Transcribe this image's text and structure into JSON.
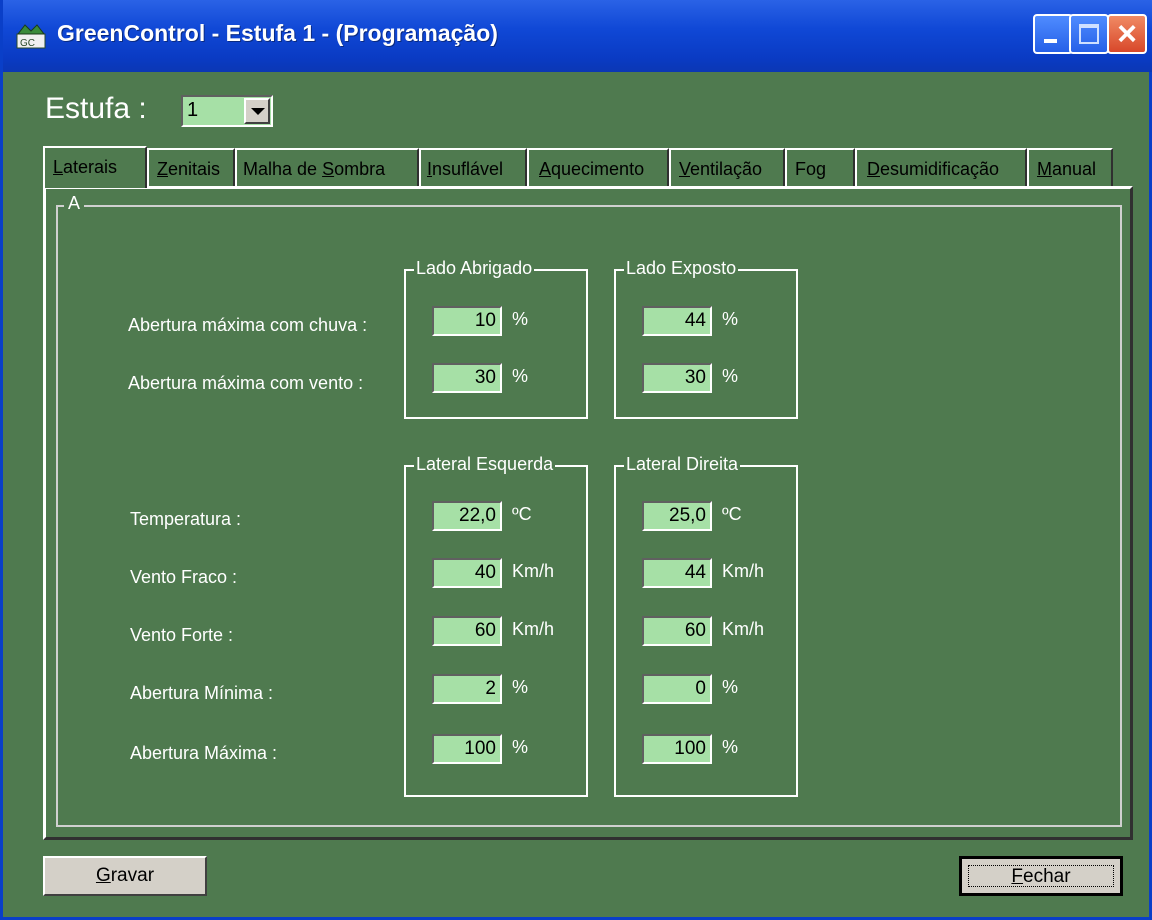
{
  "window": {
    "title": "GreenControl - Estufa 1 - (Programação)",
    "colors": {
      "titlebar": "#0a3bc4",
      "background": "#4f7a4f",
      "field": "#a6e0a6"
    }
  },
  "estufa": {
    "label": "Estufa :",
    "selected": "1"
  },
  "tabs": [
    {
      "label": "Laterais",
      "hot": "L",
      "rest": "aterais"
    },
    {
      "label": "Zenitais",
      "hot": "Z",
      "rest": "enitais"
    },
    {
      "label": "Malha de Sombra",
      "pre": "Malha de ",
      "hot": "S",
      "rest": "ombra"
    },
    {
      "label": "Insuflável",
      "hot": "I",
      "rest": "nsuflável"
    },
    {
      "label": "Aquecimento",
      "hot": "A",
      "rest": "quecimento"
    },
    {
      "label": "Ventilação",
      "hot": "V",
      "rest": "entilação"
    },
    {
      "label": "Fog",
      "pre": "Fo",
      "hot": "g",
      "rest": ""
    },
    {
      "label": "Desumidificação",
      "hot": "D",
      "rest": "esumidificação"
    },
    {
      "label": "Manual",
      "hot": "M",
      "rest": "anual"
    }
  ],
  "panel": {
    "caption": "A"
  },
  "groups": {
    "lado_abrigado": "Lado Abrigado",
    "lado_exposto": "Lado Exposto",
    "lateral_esquerda": "Lateral Esquerda",
    "lateral_direita": "Lateral Direita"
  },
  "rows_top": [
    {
      "label": "Abertura máxima com chuva :",
      "abrigado": "10",
      "exposto": "44",
      "unit": "%"
    },
    {
      "label": "Abertura máxima com vento :",
      "abrigado": "30",
      "exposto": "30",
      "unit": "%"
    }
  ],
  "rows_bottom": [
    {
      "label": "Temperatura :",
      "esquerda": "22,0",
      "direita": "25,0",
      "unit": "ºC"
    },
    {
      "label": "Vento Fraco :",
      "esquerda": "40",
      "direita": "44",
      "unit": "Km/h"
    },
    {
      "label": "Vento Forte :",
      "esquerda": "60",
      "direita": "60",
      "unit": "Km/h"
    },
    {
      "label": "Abertura Mínima :",
      "esquerda": "2",
      "direita": "0",
      "unit": "%"
    },
    {
      "label": "Abertura Máxima :",
      "esquerda": "100",
      "direita": "100",
      "unit": "%"
    }
  ],
  "buttons": {
    "gravar_hot": "G",
    "gravar_rest": "ravar",
    "fechar_hot": "F",
    "fechar_rest": "echar"
  }
}
